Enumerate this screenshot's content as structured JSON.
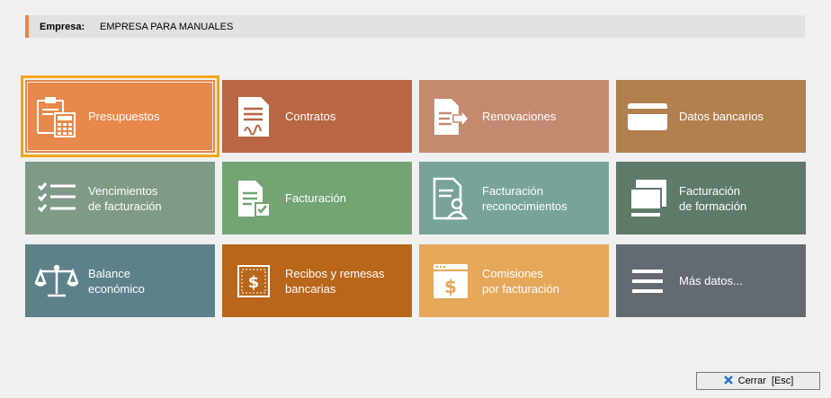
{
  "header": {
    "company_label": "Empresa:",
    "company_value": "EMPRESA PARA MANUALES"
  },
  "tiles": [
    {
      "label": "Presupuestos",
      "icon": "clipboard-calculator-icon",
      "color": "#e8884a",
      "selected": true
    },
    {
      "label": "Contratos",
      "icon": "contract-signature-icon",
      "color": "#b86644"
    },
    {
      "label": "Renovaciones",
      "icon": "document-arrow-icon",
      "color": "#c48a70"
    },
    {
      "label": "Datos bancarios",
      "icon": "credit-card-icon",
      "color": "#b0804e"
    },
    {
      "label": "Vencimientos\nde facturación",
      "icon": "checklist-icon",
      "color": "#7f9a87"
    },
    {
      "label": "Facturación",
      "icon": "invoice-check-icon",
      "color": "#73a474"
    },
    {
      "label": "Facturación\nreconocimientos",
      "icon": "document-person-icon",
      "color": "#78a39b"
    },
    {
      "label": "Facturación\nde formación",
      "icon": "books-icon",
      "color": "#5e7a68"
    },
    {
      "label": "Balance\neconómico",
      "icon": "balance-scale-icon",
      "color": "#5d8089"
    },
    {
      "label": "Recibos y remesas\nbancarias",
      "icon": "dollar-receipt-icon",
      "color": "#b8661a"
    },
    {
      "label": "Comisiones\npor facturación",
      "icon": "dollar-window-icon",
      "color": "#e5a75a"
    },
    {
      "label": "Más datos...",
      "icon": "menu-lines-icon",
      "color": "#636a72"
    }
  ],
  "close_button": {
    "label": "Cerrar  [Esc]",
    "icon": "close-x-icon",
    "icon_color": "#2a6fc9"
  }
}
